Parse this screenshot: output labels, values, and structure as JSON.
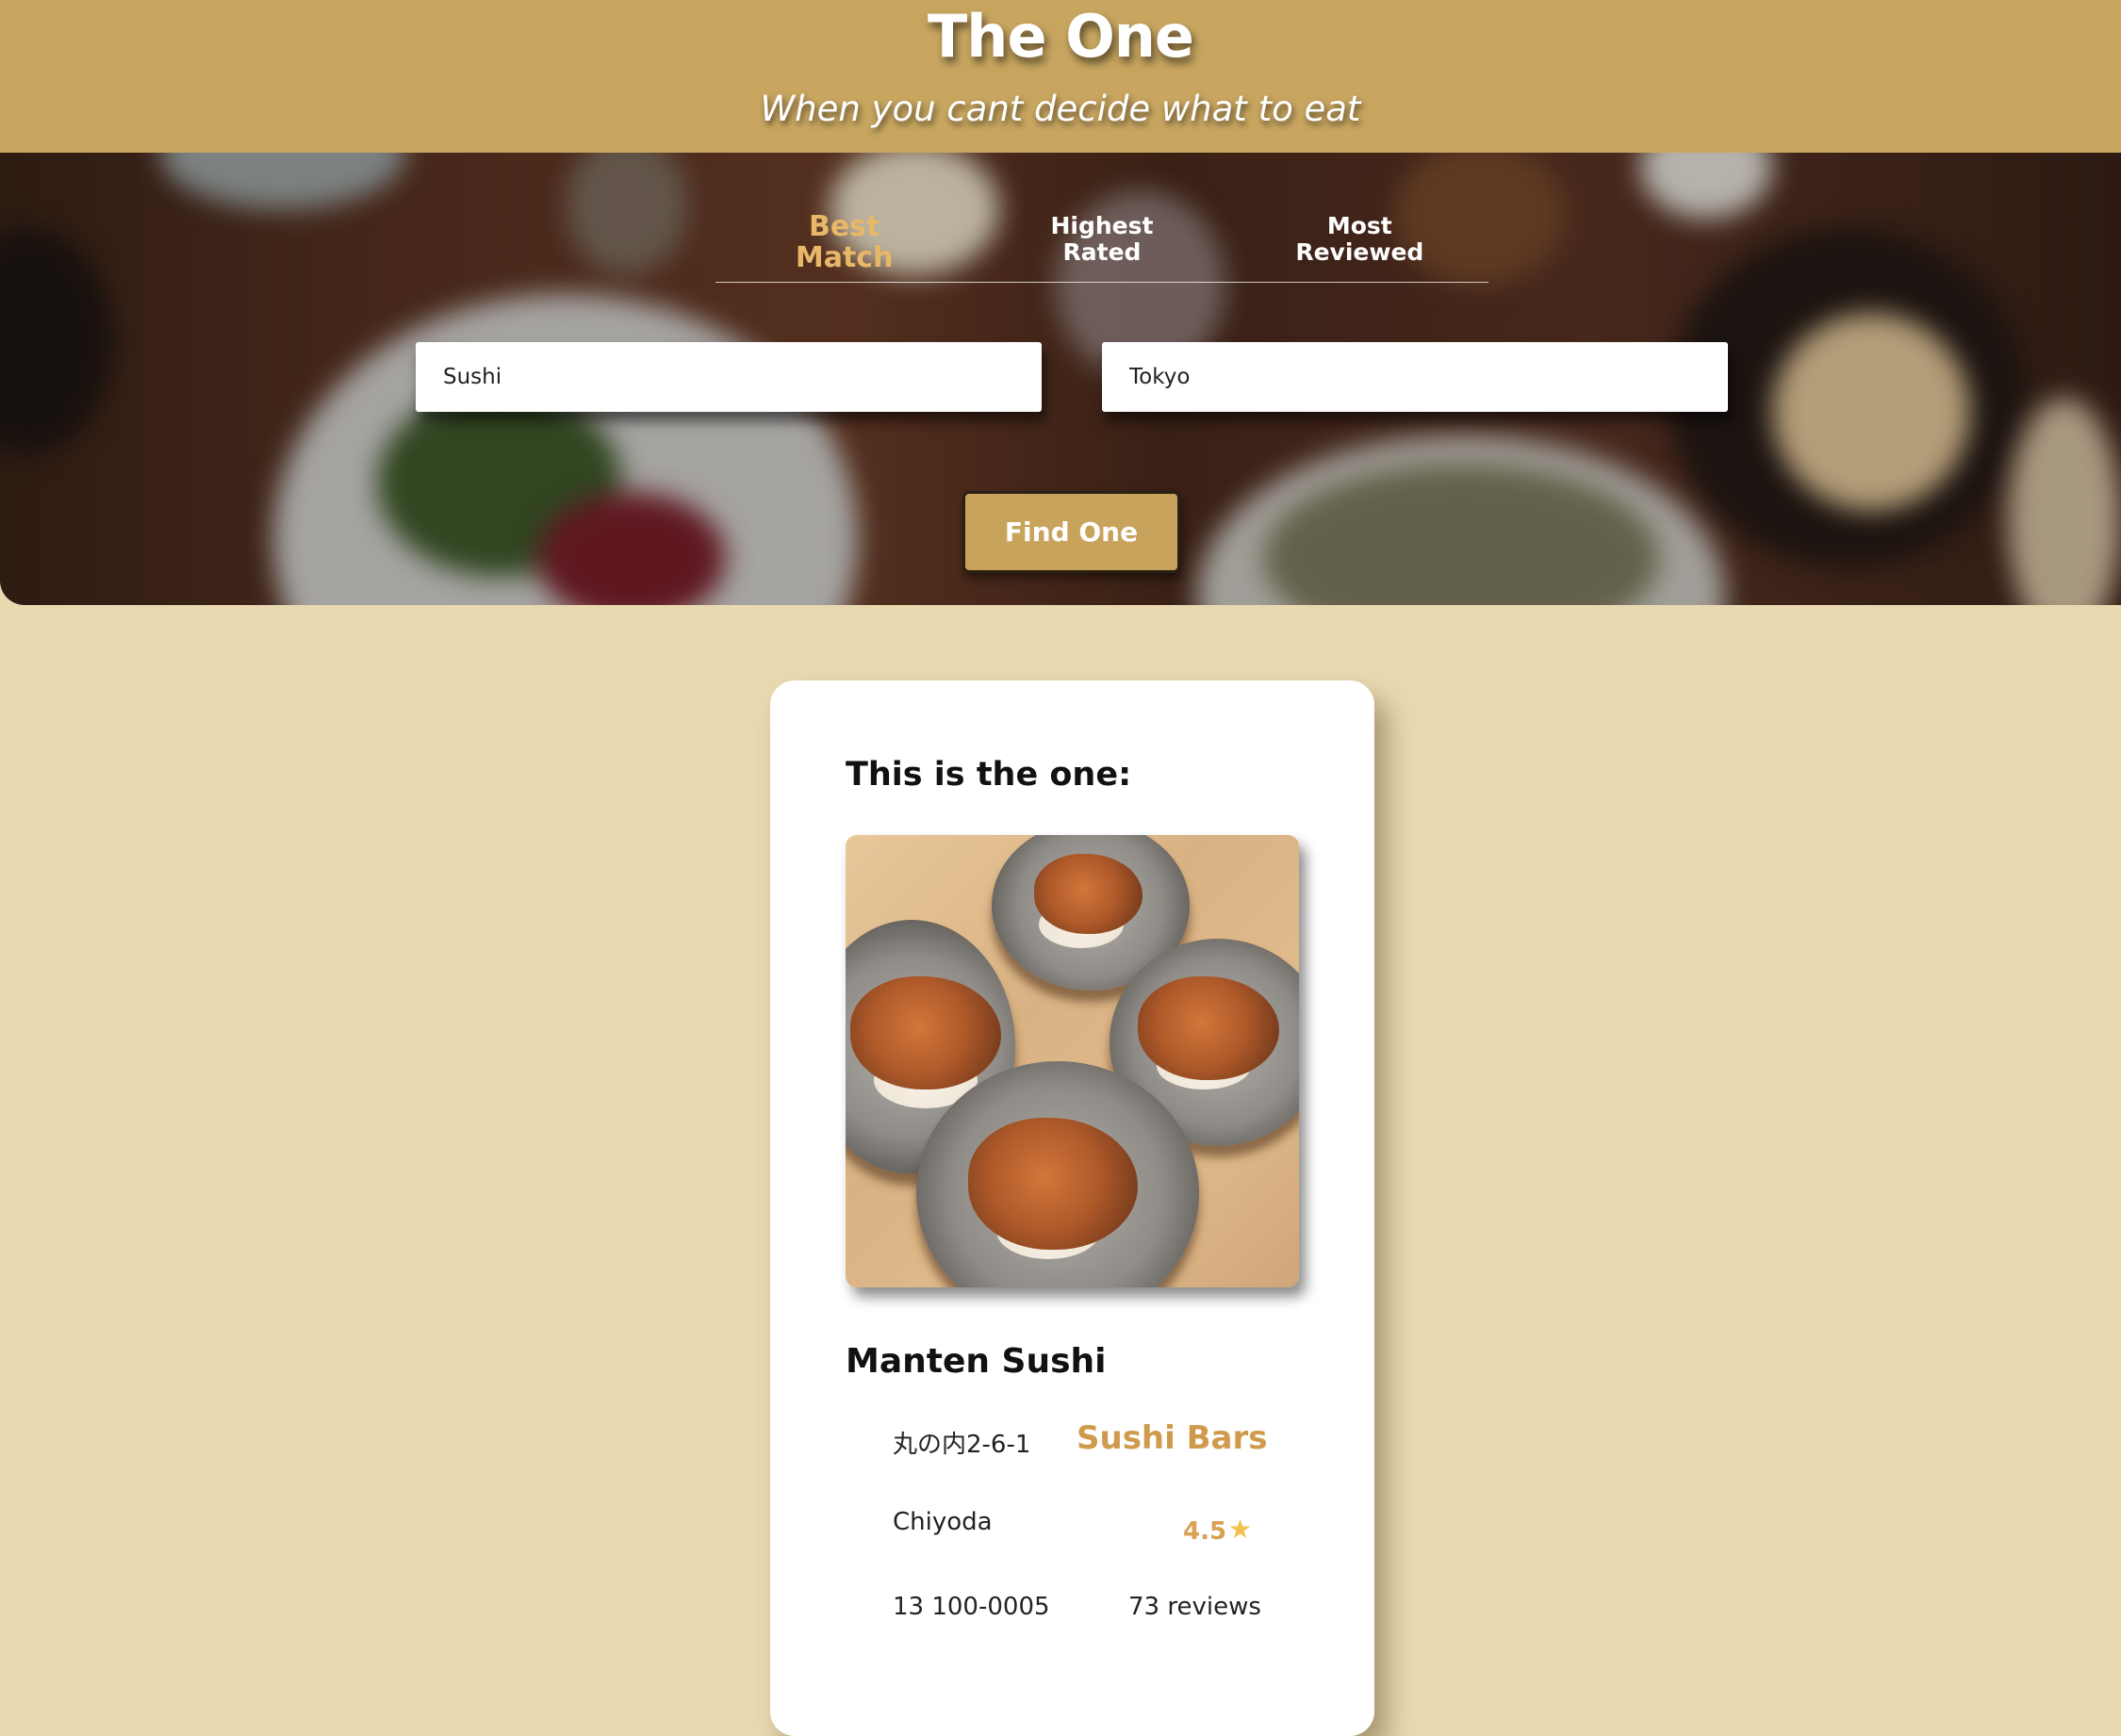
{
  "header": {
    "title": "The One",
    "tagline": "When you cant decide what to eat"
  },
  "search": {
    "tabs": [
      {
        "line1": "Best",
        "line2": "Match",
        "active": true
      },
      {
        "line1": "Highest",
        "line2": "Rated",
        "active": false
      },
      {
        "line1": "Most",
        "line2": "Reviewed",
        "active": false
      }
    ],
    "term_value": "Sushi",
    "location_value": "Tokyo",
    "button_label": "Find One"
  },
  "result": {
    "heading": "This is the one:",
    "name": "Manten Sushi",
    "address": "丸の内2-6-1",
    "city": "Chiyoda",
    "state_zip": "13 100-0005",
    "category": "Sushi Bars",
    "rating": "4.5",
    "rating_icon": "star-icon",
    "reviews": "73 reviews"
  },
  "colors": {
    "header_bg": "#c8a660",
    "page_bg": "#e9d9b1",
    "accent": "#d09a4c",
    "button_bg": "#c8a35c"
  }
}
